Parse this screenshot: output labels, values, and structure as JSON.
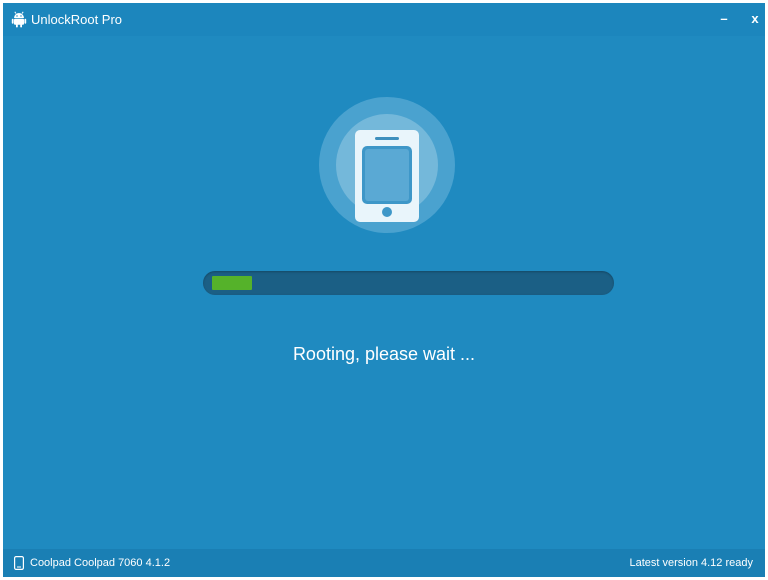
{
  "window": {
    "title": "UnlockRoot Pro",
    "minimize_glyph": "–",
    "close_glyph": "x"
  },
  "main": {
    "device_icon": "phone-icon",
    "progress_fraction": 0.1,
    "status_text": "Rooting, please wait ..."
  },
  "statusbar": {
    "device": "Coolpad Coolpad 7060 4.1.2",
    "version": "Latest version 4.12 ready"
  },
  "colors": {
    "background": "#1f8ac0",
    "progress_fill": "#55b22a",
    "progress_track": "#1b5f85"
  },
  "icons": [
    "android-icon",
    "phone-icon",
    "device-icon"
  ]
}
